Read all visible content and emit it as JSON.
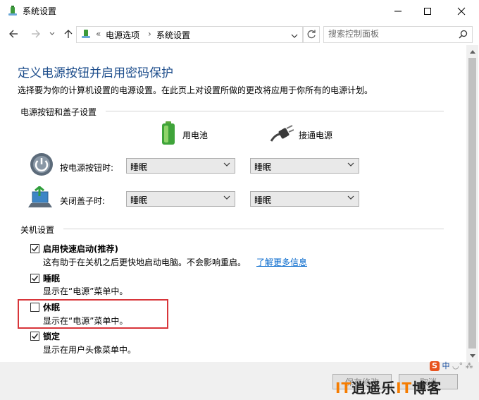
{
  "window": {
    "title": "系统设置",
    "minimize_icon": "minimize-icon",
    "maximize_icon": "maximize-icon",
    "close_icon": "close-icon"
  },
  "address_bar": {
    "crumb_separator": "«",
    "crumbs": [
      "电源选项",
      "系统设置"
    ],
    "path_separator": "›",
    "search_placeholder": "搜索控制面板"
  },
  "page": {
    "heading": "定义电源按钮并启用密码保护",
    "description": "选择要为你的计算机设置的电源设置。在此页上对设置所做的更改将应用于你所有的电源计划。"
  },
  "power_buttons": {
    "group_label": "电源按钮和盖子设置",
    "columns": [
      "用电池",
      "接通电源"
    ],
    "rows": [
      {
        "label": "按电源按钮时:",
        "battery": "睡眠",
        "plugged": "睡眠"
      },
      {
        "label": "关闭盖子时:",
        "battery": "睡眠",
        "plugged": "睡眠"
      }
    ]
  },
  "shutdown": {
    "group_label": "关机设置",
    "options": [
      {
        "title": "启用快速启动(推荐)",
        "desc": "这有助于在关机之后更快地启动电脑。不会影响重启。",
        "link": "了解更多信息",
        "checked": true
      },
      {
        "title": "睡眠",
        "desc": "显示在“电源”菜单中。",
        "checked": true
      },
      {
        "title": "休眠",
        "desc": "显示在“电源”菜单中。",
        "checked": false
      },
      {
        "title": "锁定",
        "desc": "显示在用户头像菜单中。",
        "checked": true
      }
    ]
  },
  "footer": {
    "save_label": "保存修改",
    "cancel_label": "取消"
  },
  "watermark": {
    "badge": "IT",
    "text": "逍遥乐",
    "badge2": "IT",
    "text2": "博客"
  },
  "ime": {
    "logo": "S",
    "mode": "中"
  },
  "colors": {
    "heading": "#1e4e8c",
    "link": "#0066cc",
    "highlight": "#d8353a"
  }
}
